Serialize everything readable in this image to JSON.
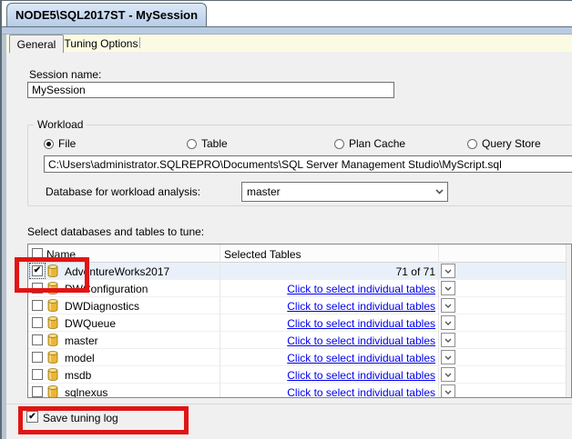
{
  "window": {
    "title_tab": "NODE5\\SQL2017ST - MySession"
  },
  "tabs": {
    "general": "General",
    "tuning_options": "Tuning Options"
  },
  "session": {
    "label": "Session name:",
    "value": "MySession"
  },
  "workload": {
    "group_label": "Workload",
    "options": [
      {
        "label": "File",
        "selected": true
      },
      {
        "label": "Table",
        "selected": false
      },
      {
        "label": "Plan Cache",
        "selected": false
      },
      {
        "label": "Query Store",
        "selected": false
      }
    ],
    "file_path": "C:\\Users\\administrator.SQLREPRO\\Documents\\SQL Server Management Studio\\MyScript.sql",
    "db_label": "Database for workload analysis:",
    "db_value": "master"
  },
  "tune": {
    "label": "Select databases and tables to tune:",
    "columns": {
      "name": "Name",
      "selected_tables": "Selected Tables"
    },
    "rows": [
      {
        "name": "AdventureWorks2017",
        "checked": true,
        "focus": true,
        "highlighted": true,
        "selected_tables": "71 of 71",
        "link": false
      },
      {
        "name": "DWConfiguration",
        "checked": false,
        "focus": false,
        "highlighted": false,
        "selected_tables": "Click to select individual tables",
        "link": true
      },
      {
        "name": "DWDiagnostics",
        "checked": false,
        "focus": false,
        "highlighted": false,
        "selected_tables": "Click to select individual tables",
        "link": true
      },
      {
        "name": "DWQueue",
        "checked": false,
        "focus": false,
        "highlighted": false,
        "selected_tables": "Click to select individual tables",
        "link": true
      },
      {
        "name": "master",
        "checked": false,
        "focus": false,
        "highlighted": false,
        "selected_tables": "Click to select individual tables",
        "link": true
      },
      {
        "name": "model",
        "checked": false,
        "focus": false,
        "highlighted": false,
        "selected_tables": "Click to select individual tables",
        "link": true
      },
      {
        "name": "msdb",
        "checked": false,
        "focus": false,
        "highlighted": false,
        "selected_tables": "Click to select individual tables",
        "link": true
      },
      {
        "name": "sqlnexus",
        "checked": false,
        "focus": false,
        "highlighted": false,
        "selected_tables": "Click to select individual tables",
        "link": true
      }
    ]
  },
  "footer": {
    "save_tuning_log": "Save tuning log",
    "checked": true
  },
  "icons": {
    "checkmark": "✔",
    "database": "database-cylinder",
    "chevron": "chevron-down"
  },
  "colors": {
    "annotation_red": "#e21414",
    "link_blue": "#0000ee",
    "tab_strip_yellow": "#fbfbe3",
    "session_tab_blue": "#b7cbe3",
    "row_highlight": "#e9f0f9"
  }
}
